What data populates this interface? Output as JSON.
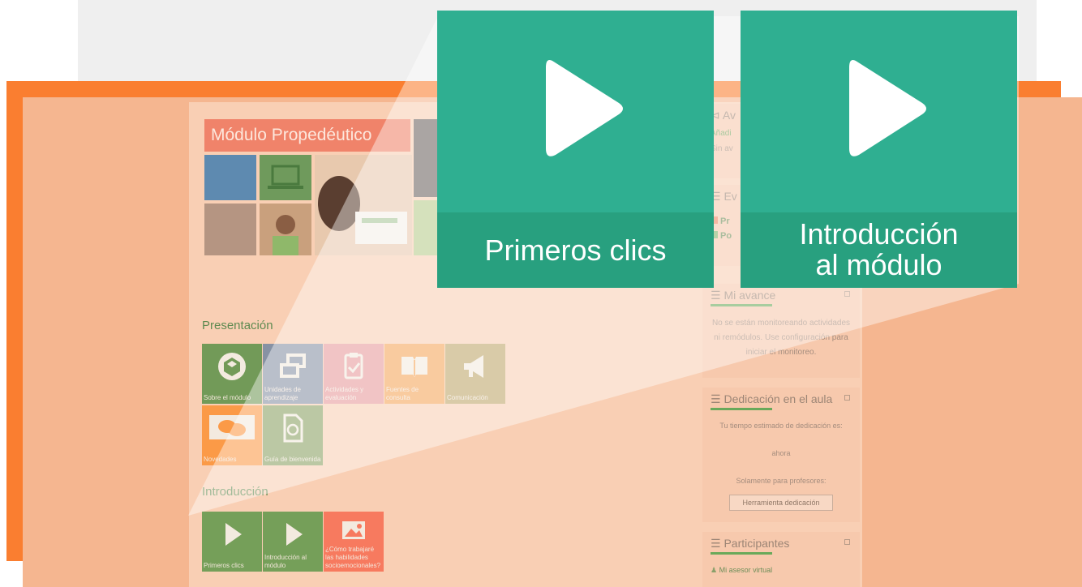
{
  "banner": {
    "title": "Módulo Propedéutico"
  },
  "presentacion": {
    "title": "Presentación",
    "tiles": [
      {
        "label": "Sobre el módulo",
        "color": "#729a58",
        "icon": "cube-icon"
      },
      {
        "label": "Unidades de aprendizaje",
        "color": "#8792a4",
        "icon": "windows-icon"
      },
      {
        "label": "Actividades y evaluación",
        "color": "#e79a9c",
        "icon": "clipboard-check-icon"
      },
      {
        "label": "Fuentes de consulta",
        "color": "#f5a55b",
        "icon": "book-icon"
      },
      {
        "label": "Comunicación",
        "color": "#bda66a",
        "icon": "megaphone-icon"
      },
      {
        "label": "Novedades",
        "color": "#fb9a47",
        "icon": "chat-bubbles-icon"
      },
      {
        "label": "Guía de bienvenida",
        "color": "#8aa162",
        "icon": "document-icon"
      }
    ]
  },
  "introduccion": {
    "title": "Introducción",
    "tiles": [
      {
        "label": "Primeros clics",
        "color": "#759f59",
        "icon": "play-icon"
      },
      {
        "label": "Introducción al módulo",
        "color": "#759f59",
        "icon": "play-icon"
      },
      {
        "label": "¿Cómo trabajaré las habilidades socioemocionales?",
        "color": "#f77a5f",
        "icon": "image-icon"
      }
    ]
  },
  "sidebar": {
    "avisos": {
      "title": "Av",
      "add": "Añadi",
      "none": "Sin av"
    },
    "eventos": {
      "title": "Ev",
      "item1": "Pr",
      "item2": "Po"
    },
    "mi_avance": {
      "title": "Mi avance",
      "text": "No se están monitoreando actividades ni remódulos. Use configuración para iniciar el monitoreo."
    },
    "dedicacion": {
      "title": "Dedicación en el aula",
      "estimated": "Tu tiempo estimado de dedicación es:",
      "value": "ahora",
      "teachers_only": "Solamente para profesores:",
      "button": "Herramienta dedicación"
    },
    "participantes": {
      "title": "Participantes",
      "advisor": "Mi asesor virtual"
    }
  },
  "video_cards": [
    {
      "label": "Primeros clics"
    },
    {
      "label": "Introducción al módulo",
      "line1": "Introducción",
      "line2": "al módulo"
    }
  ],
  "colors": {
    "orange": "#fa7e30",
    "peach": "#f5b690",
    "teal": "#2faf91",
    "teal_dark": "#28a07f",
    "green_text": "#5e8a50"
  }
}
